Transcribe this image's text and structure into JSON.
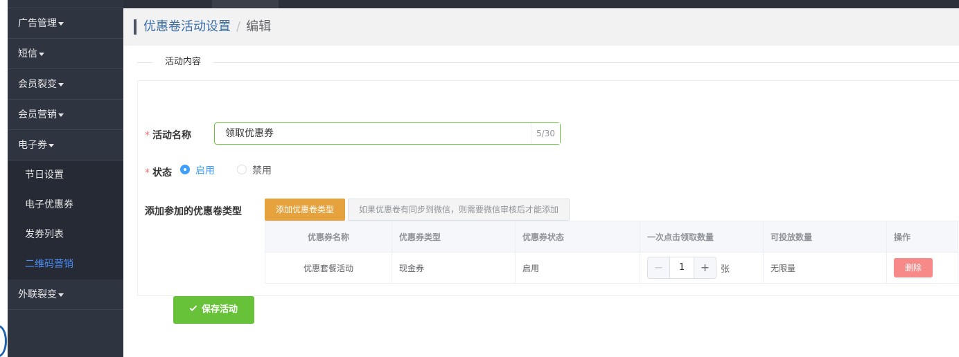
{
  "sidebar": {
    "items": [
      {
        "label": "广告管理"
      },
      {
        "label": "短信"
      },
      {
        "label": "会员裂变"
      },
      {
        "label": "会员营销"
      },
      {
        "label": "电子券"
      }
    ],
    "sub_items": [
      {
        "label": "节日设置"
      },
      {
        "label": "电子优惠券"
      },
      {
        "label": "发券列表"
      },
      {
        "label": "二维码营销",
        "active": true
      }
    ],
    "after_items": [
      {
        "label": "外联裂变"
      }
    ]
  },
  "breadcrumb": {
    "parent": "优惠卷活动设置",
    "separator": "/",
    "current": "编辑"
  },
  "section_title": "活动内容",
  "form": {
    "name_label": "活动名称",
    "name_value": "领取优惠券",
    "name_count": "5/30",
    "status_label": "状态",
    "status_options": [
      {
        "label": "启用",
        "checked": true
      },
      {
        "label": "禁用",
        "checked": false
      }
    ],
    "coupon_types_label": "添加参加的优惠卷类型",
    "add_button": "添加优惠卷类型",
    "tip_button": "如果优惠卷有同步到微信，则需要微信审核后才能添加",
    "save_button": "保存活动"
  },
  "table": {
    "headers": [
      "优惠券名称",
      "优惠券类型",
      "优惠券状态",
      "一次点击领取数量",
      "可投放数量",
      "操作"
    ],
    "rows": [
      {
        "name": "优惠套餐活动",
        "type": "现金券",
        "status": "启用",
        "quantity": "1",
        "unit": "张",
        "available": "无限量",
        "action": "删除"
      }
    ]
  },
  "colors": {
    "sidebar_bg": "#2f3441",
    "accent_blue": "#409eff",
    "active_menu": "#4d8cf5",
    "warning": "#e6a23c",
    "success": "#67c23a",
    "danger": "#f78989"
  }
}
